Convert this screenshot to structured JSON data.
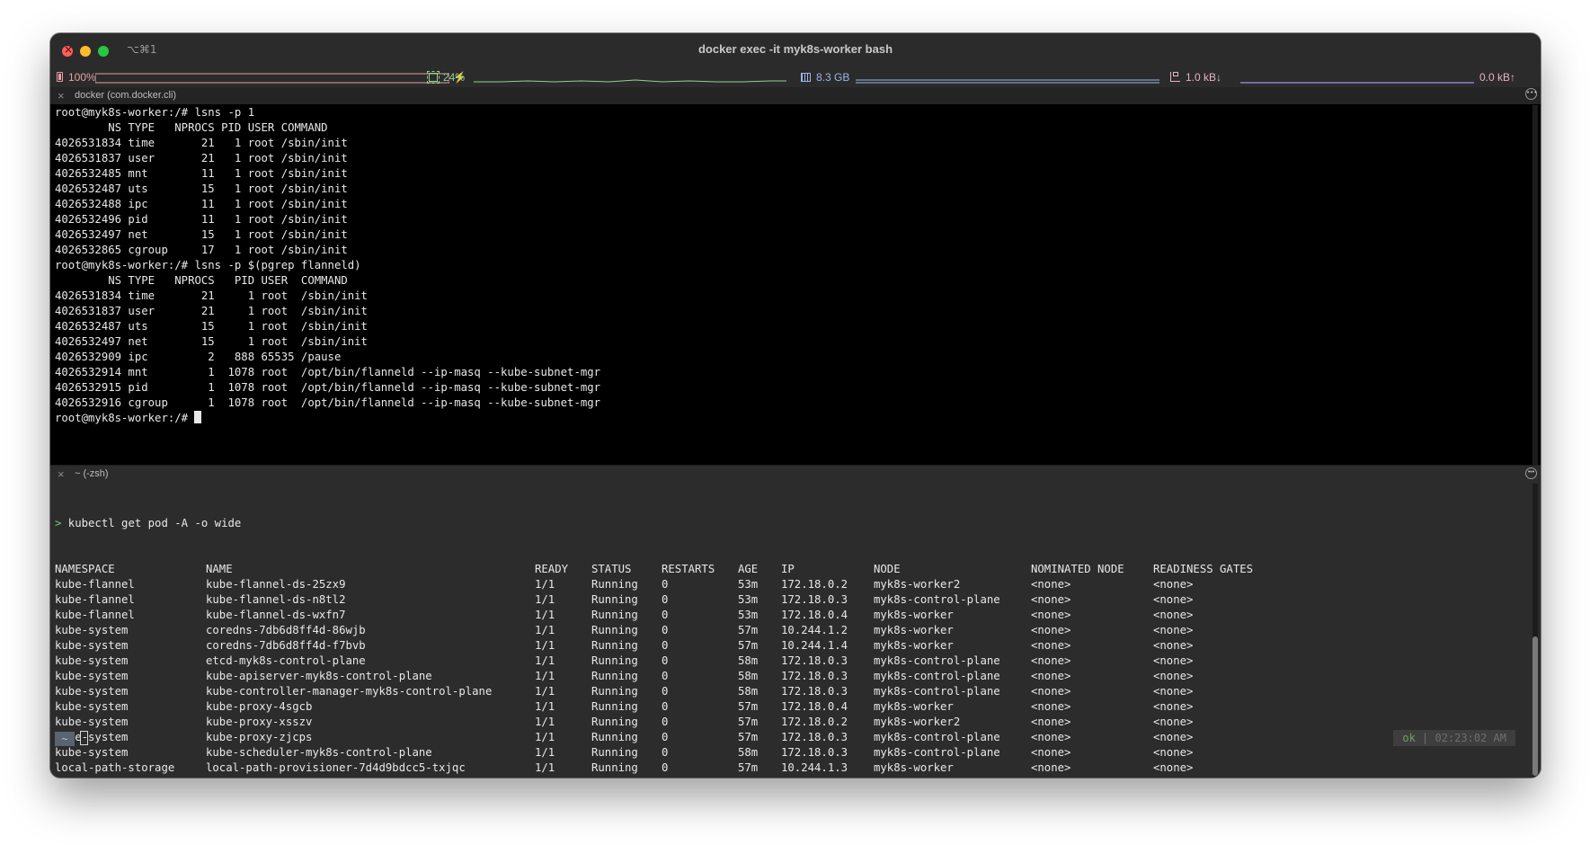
{
  "window": {
    "shortcut": "⌥⌘1",
    "title": "docker exec -it myk8s-worker bash"
  },
  "statusbar": {
    "battery": "100%",
    "charging_icon": "⚡",
    "cpu": "24%",
    "memory": "8.3 GB",
    "net_down": "1.0 kB↓",
    "net_up": "0.0 kB↑",
    "colors": {
      "battery": "#e5a0a0",
      "cpu": "#8fd38f",
      "memory": "#9db4e6",
      "net_down": "#e6b0c8",
      "net_up": "#a58fe6"
    }
  },
  "top_pane": {
    "header": "docker (com.docker.cli)",
    "lines": [
      "root@myk8s-worker:/# lsns -p 1",
      "        NS TYPE   NPROCS PID USER COMMAND",
      "4026531834 time       21   1 root /sbin/init",
      "4026531837 user       21   1 root /sbin/init",
      "4026532485 mnt        11   1 root /sbin/init",
      "4026532487 uts        15   1 root /sbin/init",
      "4026532488 ipc        11   1 root /sbin/init",
      "4026532496 pid        11   1 root /sbin/init",
      "4026532497 net        15   1 root /sbin/init",
      "4026532865 cgroup     17   1 root /sbin/init",
      "root@myk8s-worker:/# lsns -p $(pgrep flanneld)",
      "        NS TYPE   NPROCS   PID USER  COMMAND",
      "4026531834 time       21     1 root  /sbin/init",
      "4026531837 user       21     1 root  /sbin/init",
      "4026532487 uts        15     1 root  /sbin/init",
      "4026532497 net        15     1 root  /sbin/init",
      "4026532909 ipc         2   888 65535 /pause",
      "4026532914 mnt         1  1078 root  /opt/bin/flanneld --ip-masq --kube-subnet-mgr",
      "4026532915 pid         1  1078 root  /opt/bin/flanneld --ip-masq --kube-subnet-mgr",
      "4026532916 cgroup      1  1078 root  /opt/bin/flanneld --ip-masq --kube-subnet-mgr"
    ],
    "prompt": "root@myk8s-worker:/# "
  },
  "bottom_pane": {
    "header": "~ (-zsh)",
    "prompt_symbol": ">",
    "command": " kubectl get pod -A -o wide",
    "columns": [
      "NAMESPACE",
      "NAME",
      "READY",
      "STATUS",
      "RESTARTS",
      "AGE",
      "IP",
      "NODE",
      "NOMINATED NODE",
      "READINESS GATES"
    ],
    "rows": [
      [
        "kube-flannel",
        "kube-flannel-ds-25zx9",
        "1/1",
        "Running",
        "0",
        "53m",
        "172.18.0.2",
        "myk8s-worker2",
        "<none>",
        "<none>"
      ],
      [
        "kube-flannel",
        "kube-flannel-ds-n8tl2",
        "1/1",
        "Running",
        "0",
        "53m",
        "172.18.0.3",
        "myk8s-control-plane",
        "<none>",
        "<none>"
      ],
      [
        "kube-flannel",
        "kube-flannel-ds-wxfn7",
        "1/1",
        "Running",
        "0",
        "53m",
        "172.18.0.4",
        "myk8s-worker",
        "<none>",
        "<none>"
      ],
      [
        "kube-system",
        "coredns-7db6d8ff4d-86wjb",
        "1/1",
        "Running",
        "0",
        "57m",
        "10.244.1.2",
        "myk8s-worker",
        "<none>",
        "<none>"
      ],
      [
        "kube-system",
        "coredns-7db6d8ff4d-f7bvb",
        "1/1",
        "Running",
        "0",
        "57m",
        "10.244.1.4",
        "myk8s-worker",
        "<none>",
        "<none>"
      ],
      [
        "kube-system",
        "etcd-myk8s-control-plane",
        "1/1",
        "Running",
        "0",
        "58m",
        "172.18.0.3",
        "myk8s-control-plane",
        "<none>",
        "<none>"
      ],
      [
        "kube-system",
        "kube-apiserver-myk8s-control-plane",
        "1/1",
        "Running",
        "0",
        "58m",
        "172.18.0.3",
        "myk8s-control-plane",
        "<none>",
        "<none>"
      ],
      [
        "kube-system",
        "kube-controller-manager-myk8s-control-plane",
        "1/1",
        "Running",
        "0",
        "58m",
        "172.18.0.3",
        "myk8s-control-plane",
        "<none>",
        "<none>"
      ],
      [
        "kube-system",
        "kube-proxy-4sgcb",
        "1/1",
        "Running",
        "0",
        "57m",
        "172.18.0.4",
        "myk8s-worker",
        "<none>",
        "<none>"
      ],
      [
        "kube-system",
        "kube-proxy-xsszv",
        "1/1",
        "Running",
        "0",
        "57m",
        "172.18.0.2",
        "myk8s-worker2",
        "<none>",
        "<none>"
      ],
      [
        "kube-system",
        "kube-proxy-zjcps",
        "1/1",
        "Running",
        "0",
        "57m",
        "172.18.0.3",
        "myk8s-control-plane",
        "<none>",
        "<none>"
      ],
      [
        "kube-system",
        "kube-scheduler-myk8s-control-plane",
        "1/1",
        "Running",
        "0",
        "58m",
        "172.18.0.3",
        "myk8s-control-plane",
        "<none>",
        "<none>"
      ],
      [
        "local-path-storage",
        "local-path-provisioner-7d4d9bdcc5-txjqc",
        "1/1",
        "Running",
        "0",
        "57m",
        "10.244.1.3",
        "myk8s-worker",
        "<none>",
        "<none>"
      ]
    ],
    "shell_tilde": "~",
    "status_ok": "ok",
    "status_sep": " | ",
    "status_time": "02:23:02 AM"
  }
}
